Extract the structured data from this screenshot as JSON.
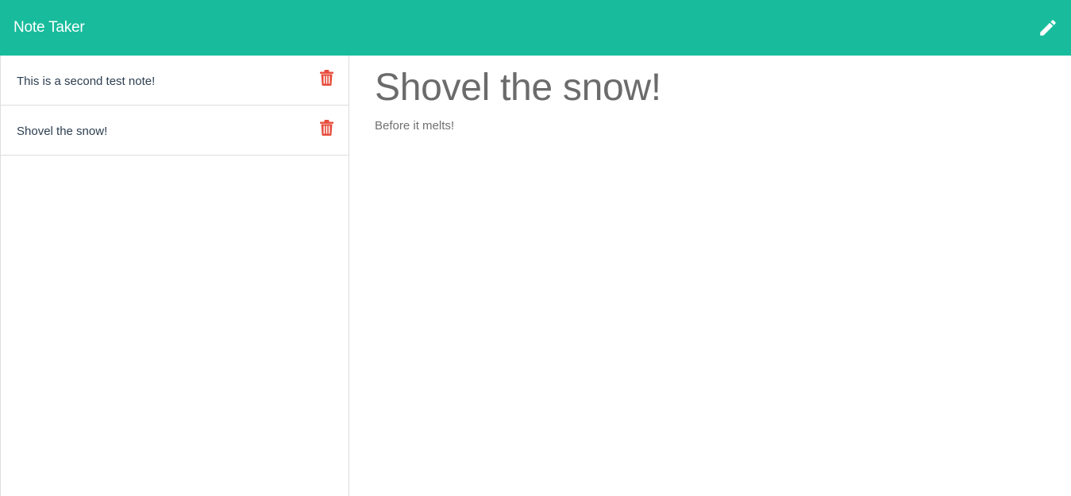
{
  "app": {
    "brand": "Note Taker",
    "accent_color": "#18bc9c",
    "delete_color": "#e74c3c"
  },
  "toolbar": {
    "new_note_icon": "pencil-icon"
  },
  "notes": [
    {
      "title": "This is a second test note!",
      "delete_icon": "trash-icon"
    },
    {
      "title": "Shovel the snow!",
      "delete_icon": "trash-icon"
    }
  ],
  "active_note": {
    "title": "Shovel the snow!",
    "text": "Before it melts!"
  }
}
